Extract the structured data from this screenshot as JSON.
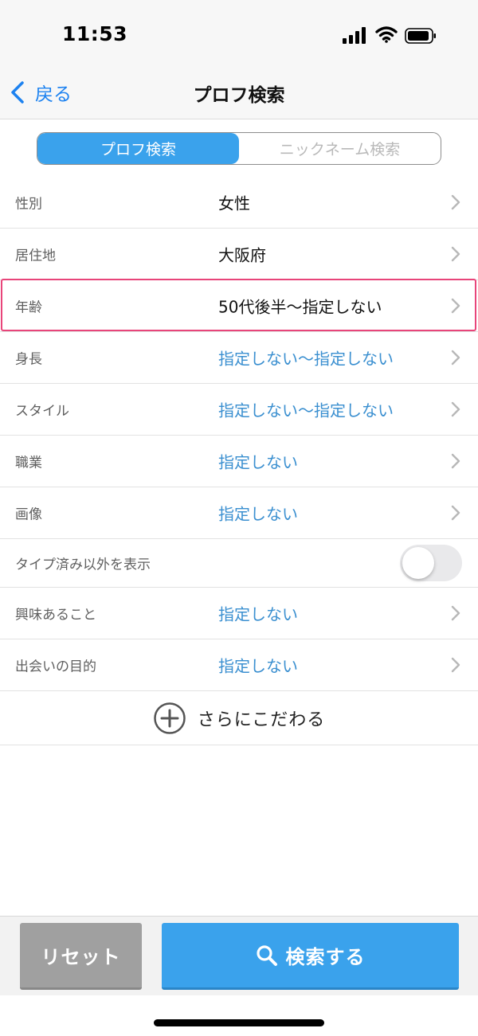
{
  "status_bar": {
    "time": "11:53"
  },
  "nav": {
    "back_label": "戻る",
    "title": "プロフ検索"
  },
  "segment": {
    "active_label": "プロフ検索",
    "inactive_label": "ニックネーム検索"
  },
  "rows": [
    {
      "label": "性別",
      "value": "女性",
      "state": "set"
    },
    {
      "label": "居住地",
      "value": "大阪府",
      "state": "set"
    },
    {
      "label": "年齢",
      "value": "50代後半～指定しない",
      "state": "set",
      "highlighted": true
    },
    {
      "label": "身長",
      "value": "指定しない～指定しない",
      "state": "unset"
    },
    {
      "label": "スタイル",
      "value": "指定しない～指定しない",
      "state": "unset"
    },
    {
      "label": "職業",
      "value": "指定しない",
      "state": "unset"
    },
    {
      "label": "画像",
      "value": "指定しない",
      "state": "unset"
    }
  ],
  "toggle_row": {
    "label": "タイプ済み以外を表示",
    "on": false
  },
  "rows2": [
    {
      "label": "興味あること",
      "value": "指定しない",
      "state": "unset"
    },
    {
      "label": "出会いの目的",
      "value": "指定しない",
      "state": "unset"
    }
  ],
  "more": {
    "label": "さらにこだわる"
  },
  "bottom": {
    "reset_label": "リセット",
    "search_label": "検索する"
  },
  "colors": {
    "accent": "#3aa2ec",
    "link": "#1d82f0",
    "unset_value": "#3a8fd0",
    "highlight": "#e8457a",
    "reset": "#a0a0a0"
  },
  "icons": {
    "back": "chevron-left-icon",
    "row": "chevron-right-icon",
    "more": "plus-circle-icon",
    "search": "search-icon",
    "signal": "cellular-signal-icon",
    "wifi": "wifi-icon",
    "battery": "battery-icon"
  }
}
